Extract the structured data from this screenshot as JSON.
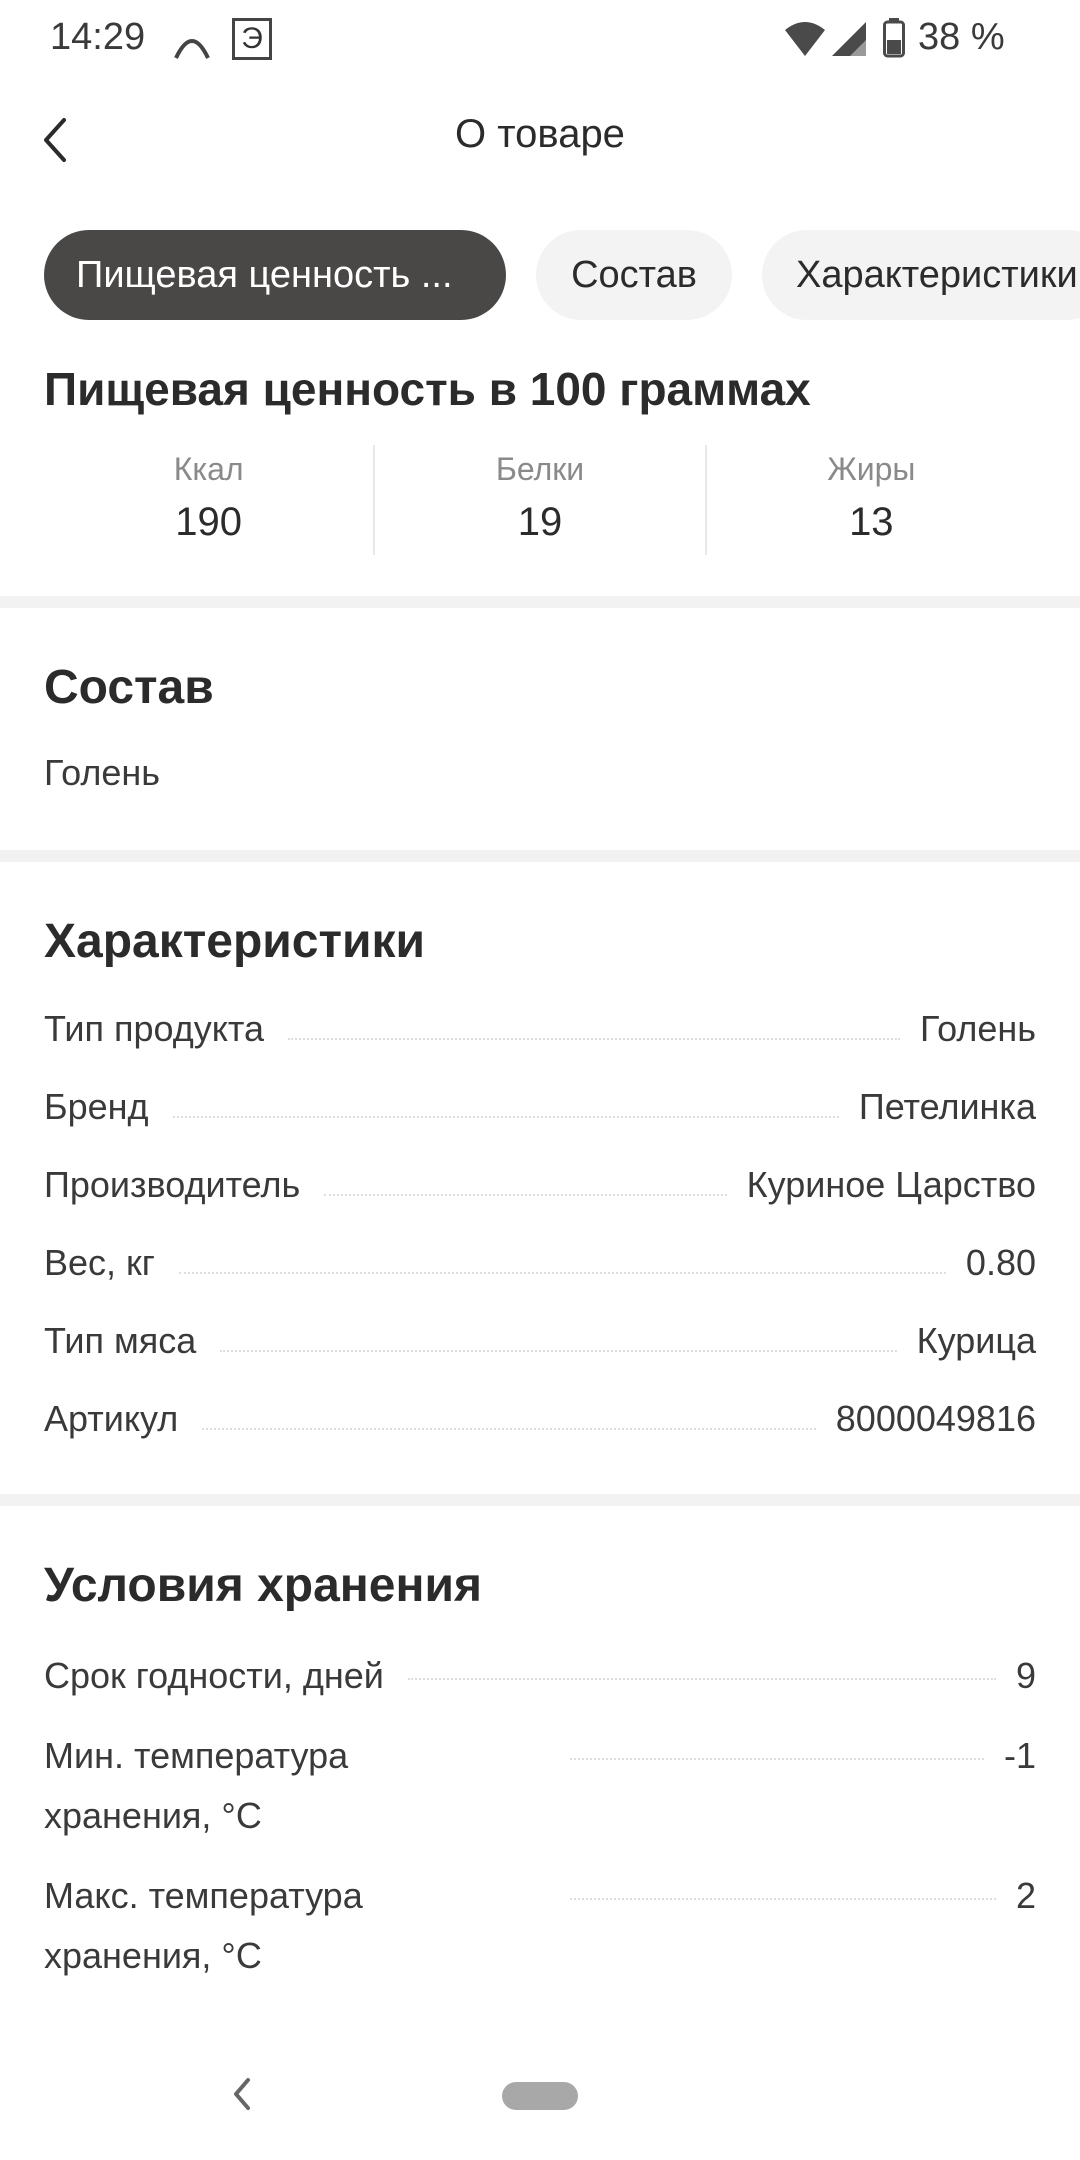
{
  "status_bar": {
    "time": "14:29",
    "e_badge": "Э",
    "battery": "38 %",
    "icons": [
      "arc-icon",
      "e-badge-icon",
      "wifi-icon",
      "signal-icon",
      "battery-icon"
    ]
  },
  "header": {
    "title": "О товаре",
    "back_icon": "chevron-left-icon"
  },
  "tabs": [
    {
      "label": "Пищевая ценность ...",
      "active": true
    },
    {
      "label": "Состав",
      "active": false
    },
    {
      "label": "Характеристики",
      "active": false
    }
  ],
  "nutrition": {
    "title": "Пищевая ценность в 100 граммах",
    "items": [
      {
        "label": "Ккал",
        "value": "190"
      },
      {
        "label": "Белки",
        "value": "19"
      },
      {
        "label": "Жиры",
        "value": "13"
      }
    ]
  },
  "composition": {
    "title": "Состав",
    "text": "Голень"
  },
  "characteristics": {
    "title": "Характеристики",
    "rows": [
      {
        "label": "Тип продукта",
        "value": "Голень"
      },
      {
        "label": "Бренд",
        "value": "Петелинка"
      },
      {
        "label": "Производитель",
        "value": "Куриное Царство"
      },
      {
        "label": "Вес, кг",
        "value": "0.80"
      },
      {
        "label": "Тип мяса",
        "value": "Курица"
      },
      {
        "label": "Артикул",
        "value": "8000049816"
      }
    ]
  },
  "storage": {
    "title": "Условия хранения",
    "rows": [
      {
        "label": "Срок годности, дней",
        "value": "9"
      },
      {
        "label": "Мин. температура хранения, °C",
        "value": "-1"
      },
      {
        "label": "Макс. температура хранения, °C",
        "value": "2"
      }
    ]
  },
  "nav_bar": {
    "icons": [
      "nav-back-icon",
      "home-pill-icon"
    ]
  },
  "colors": {
    "active_tab_bg": "#4a4846",
    "inactive_tab_bg": "#f3f3f3",
    "divider": "#f2f2f2",
    "text": "#2b2b2b",
    "muted": "#8a8a8a"
  }
}
